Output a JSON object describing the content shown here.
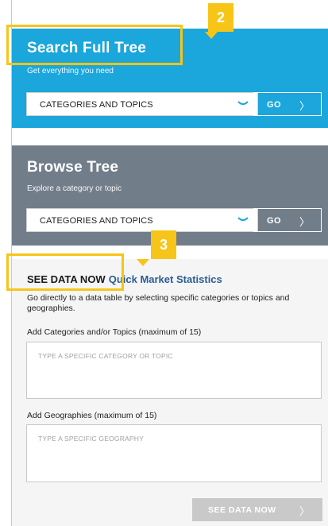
{
  "search_panel": {
    "title": "Search Full Tree",
    "subtitle": "Get everything you need",
    "select_value": "CATEGORIES AND TOPICS",
    "go_label": "GO",
    "go_arrow": "〉",
    "bg_color": "#1ba6dc"
  },
  "browse_panel": {
    "title": "Browse Tree",
    "subtitle": "Explore a category or topic",
    "select_value": "CATEGORIES AND TOPICS",
    "go_label": "GO",
    "go_arrow": "〉",
    "bg_color": "#727d8a"
  },
  "data_section": {
    "heading": "SEE DATA NOW",
    "subheading": "Quick Market Statistics",
    "description": "Go directly to a data table by selecting specific categories or topics and geographies.",
    "categories_label": "Add Categories and/or Topics (maximum of 15)",
    "categories_placeholder": "TYPE A SPECIFIC CATEGORY OR TOPIC",
    "geographies_label": "Add Geographies (maximum of 15)",
    "geographies_placeholder": "TYPE A SPECIFIC GEOGRAPHY",
    "see_button_label": "SEE DATA NOW",
    "see_button_arrow": "〉"
  },
  "annotations": {
    "badge_2": "2",
    "badge_3": "3",
    "highlight_color": "#f7c518"
  }
}
